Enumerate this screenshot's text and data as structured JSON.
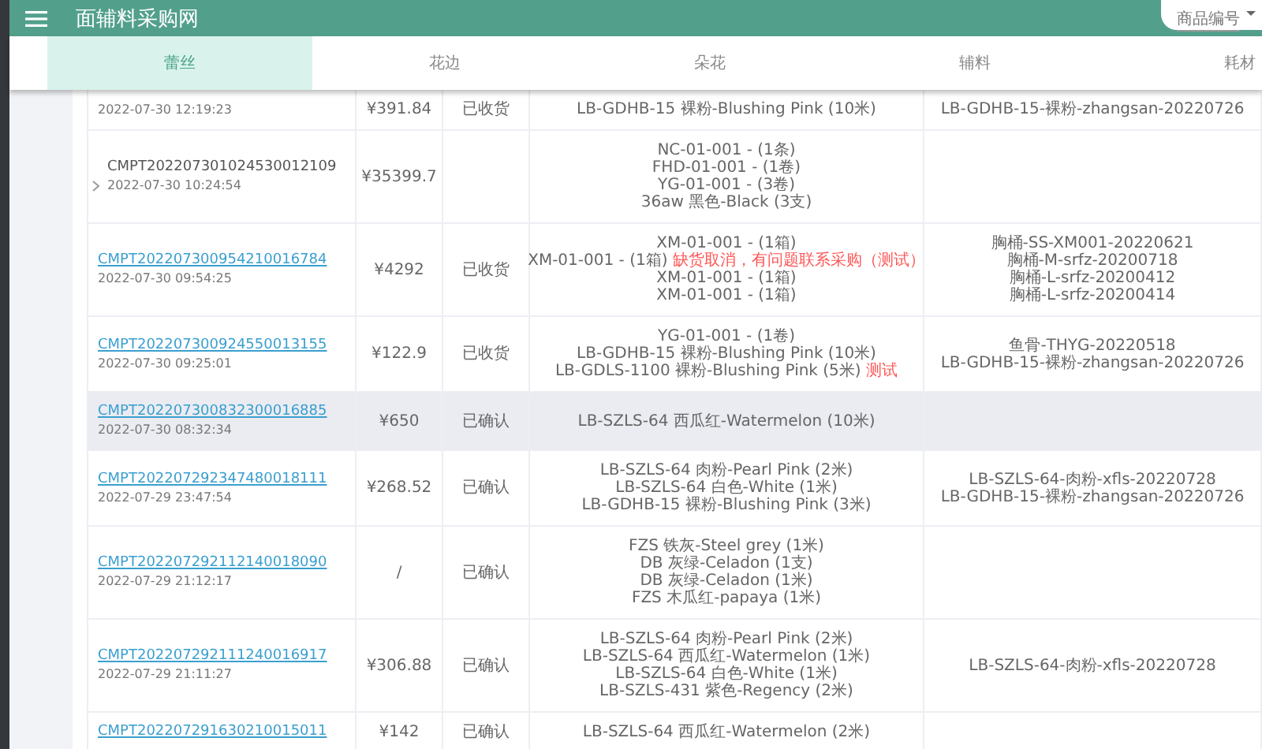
{
  "header": {
    "title": "面辅料采购网",
    "search_type": "商品编号"
  },
  "tabs": [
    {
      "label": "蕾丝",
      "selected": true
    },
    {
      "label": "花边",
      "selected": false
    },
    {
      "label": "朵花",
      "selected": false
    },
    {
      "label": "辅料",
      "selected": false
    },
    {
      "label": "耗材",
      "selected": false
    }
  ],
  "orders": [
    {
      "date": "2022-07-30 12:19:23",
      "amount": "¥391.84",
      "status": "已收货",
      "highlighted": false,
      "items": [
        {
          "text": "LB-GDHB-15 裸粉-Blushing Pink (10米)"
        }
      ],
      "remarks": [
        "LB-GDHB-15-裸粉-zhangsan-20220726"
      ]
    },
    {
      "order_no": "CMPT202207301024530012109",
      "date": "2022-07-30 10:24:54",
      "amount": "¥35399.7",
      "link": false,
      "expandable": true,
      "highlighted": false,
      "items": [
        {
          "text": "NC-01-001 - (1条)"
        },
        {
          "text": "FHD-01-001 - (1卷)"
        },
        {
          "text": "YG-01-001 - (3卷)"
        },
        {
          "text": "36aw 黑色-Black (3支)"
        }
      ]
    },
    {
      "order_no": "CMPT202207300954210016784",
      "date": "2022-07-30 09:54:25",
      "amount": "¥4292",
      "status": "已收货",
      "link": true,
      "expandable": false,
      "highlighted": false,
      "items": [
        {
          "text": "XM-01-001 - (1箱)"
        },
        {
          "text": "XM-01-001 - (1箱)",
          "note": "缺货取消，有问题联系采购（测试）"
        },
        {
          "text": "XM-01-001 - (1箱)"
        },
        {
          "text": "XM-01-001 - (1箱)"
        }
      ],
      "remarks": [
        "胸桶-SS-XM001-20220621",
        "胸桶-M-srfz-20200718",
        "胸桶-L-srfz-20200412",
        "胸桶-L-srfz-20200414"
      ]
    },
    {
      "order_no": "CMPT202207300924550013155",
      "date": "2022-07-30 09:25:01",
      "amount": "¥122.9",
      "status": "已收货",
      "link": true,
      "expandable": false,
      "highlighted": false,
      "items": [
        {
          "text": "YG-01-001 - (1卷)"
        },
        {
          "text": "LB-GDHB-15 裸粉-Blushing Pink (10米)"
        },
        {
          "text": "LB-GDLS-1100 裸粉-Blushing Pink (5米)",
          "note": "测试"
        }
      ],
      "remarks": [
        "鱼骨-THYG-20220518",
        "LB-GDHB-15-裸粉-zhangsan-20220726"
      ]
    },
    {
      "order_no": "CMPT202207300832300016885",
      "date": "2022-07-30 08:32:34",
      "amount": "¥650",
      "status": "已确认",
      "link": true,
      "expandable": false,
      "highlighted": true,
      "items": [
        {
          "text": "LB-SZLS-64 西瓜红-Watermelon (10米)"
        }
      ]
    },
    {
      "order_no": "CMPT202207292347480018111",
      "date": "2022-07-29 23:47:54",
      "amount": "¥268.52",
      "status": "已确认",
      "link": true,
      "expandable": false,
      "highlighted": false,
      "items": [
        {
          "text": "LB-SZLS-64 肉粉-Pearl Pink (2米)"
        },
        {
          "text": "LB-SZLS-64 白色-White (1米)"
        },
        {
          "text": "LB-GDHB-15 裸粉-Blushing Pink (3米)"
        }
      ],
      "remarks": [
        "LB-SZLS-64-肉粉-xfls-20220728",
        "LB-GDHB-15-裸粉-zhangsan-20220726"
      ]
    },
    {
      "order_no": "CMPT202207292112140018090",
      "date": "2022-07-29 21:12:17",
      "amount": "/",
      "status": "已确认",
      "link": true,
      "expandable": false,
      "highlighted": false,
      "items": [
        {
          "text": "FZS 铁灰-Steel grey (1米)"
        },
        {
          "text": "DB 灰绿-Celadon (1支)"
        },
        {
          "text": "DB 灰绿-Celadon (1米)"
        },
        {
          "text": "FZS 木瓜红-papaya (1米)"
        }
      ]
    },
    {
      "order_no": "CMPT202207292111240016917",
      "date": "2022-07-29 21:11:27",
      "amount": "¥306.88",
      "status": "已确认",
      "link": true,
      "expandable": false,
      "highlighted": false,
      "items": [
        {
          "text": "LB-SZLS-64 肉粉-Pearl Pink (2米)"
        },
        {
          "text": "LB-SZLS-64 西瓜红-Watermelon (1米)"
        },
        {
          "text": "LB-SZLS-64 白色-White (1米)"
        },
        {
          "text": "LB-SZLS-431 紫色-Regency (2米)"
        }
      ],
      "remarks": [
        "LB-SZLS-64-肉粉-xfls-20220728"
      ]
    },
    {
      "order_no": "CMPT202207291630210015011",
      "amount": "¥142",
      "status": "已确认",
      "link": true,
      "expandable": false,
      "highlighted": false,
      "items": [
        {
          "text": "LB-SZLS-64 西瓜红-Watermelon (2米)"
        }
      ]
    }
  ]
}
